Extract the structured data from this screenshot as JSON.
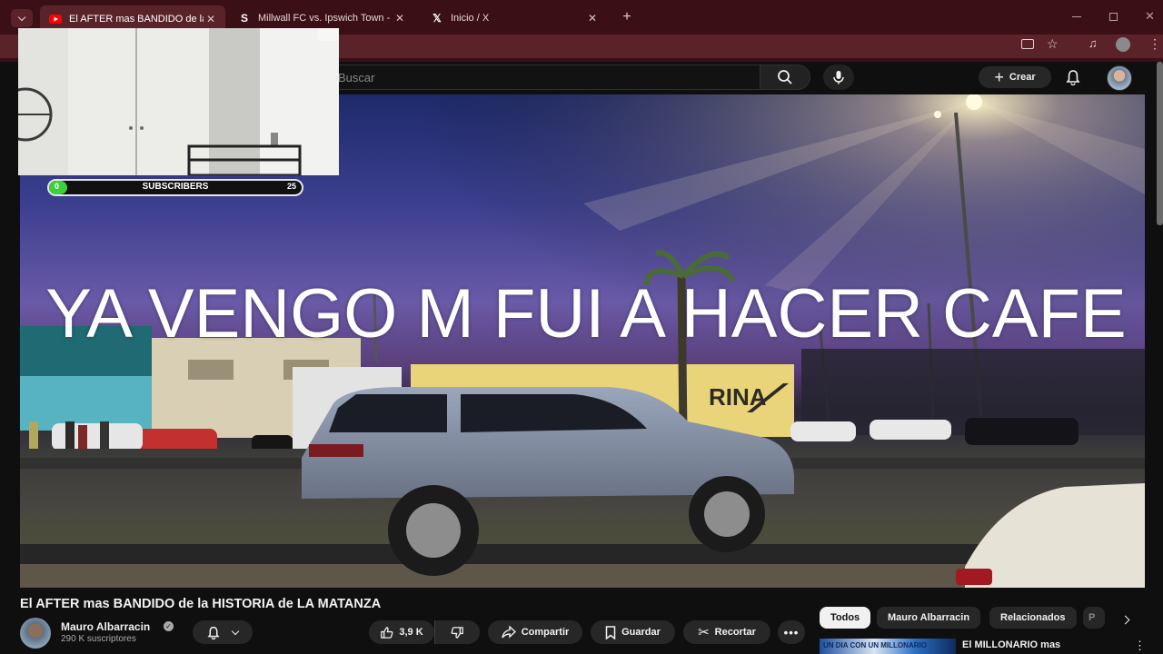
{
  "browser": {
    "tabs": [
      {
        "title": "El AFTER mas BANDIDO de la H",
        "favicon": "youtube-icon",
        "active": true
      },
      {
        "title": "Millwall FC vs. Ipswich Town - S",
        "favicon": "sofascore-icon",
        "active": false
      },
      {
        "title": "Inicio / X",
        "favicon": "x-icon",
        "active": false
      }
    ],
    "new_tab_label": "+"
  },
  "header": {
    "search_placeholder": "Buscar",
    "create_label": "Crear"
  },
  "overlay": {
    "caption": "YA VENGO M FUI A HACER CAFE",
    "subscribers_label": "SUBSCRIBERS",
    "subscribers_start": "0",
    "subscribers_goal": "25",
    "subscribers_progress": 0.0
  },
  "video_scene": {
    "truck_logo": "RINA"
  },
  "video": {
    "title": "El AFTER mas BANDIDO de la HISTORIA de LA MATANZA",
    "channel": "Mauro Albarracin",
    "subscribers": "290 K suscriptores",
    "likes": "3,9 K",
    "share_label": "Compartir",
    "save_label": "Guardar",
    "clip_label": "Recortar"
  },
  "chips": [
    "Todos",
    "Mauro Albarracin",
    "Relacionados",
    "P"
  ],
  "related": {
    "title": "El MILLONARIO mas",
    "thumb_text": "UN DIA CON UN MILLONARIO"
  },
  "colors": {
    "tabbar": "#3a0f15",
    "toolbar": "#5a2329",
    "page_bg": "#0f0f0f",
    "progress_green": "#3ccf3c"
  }
}
